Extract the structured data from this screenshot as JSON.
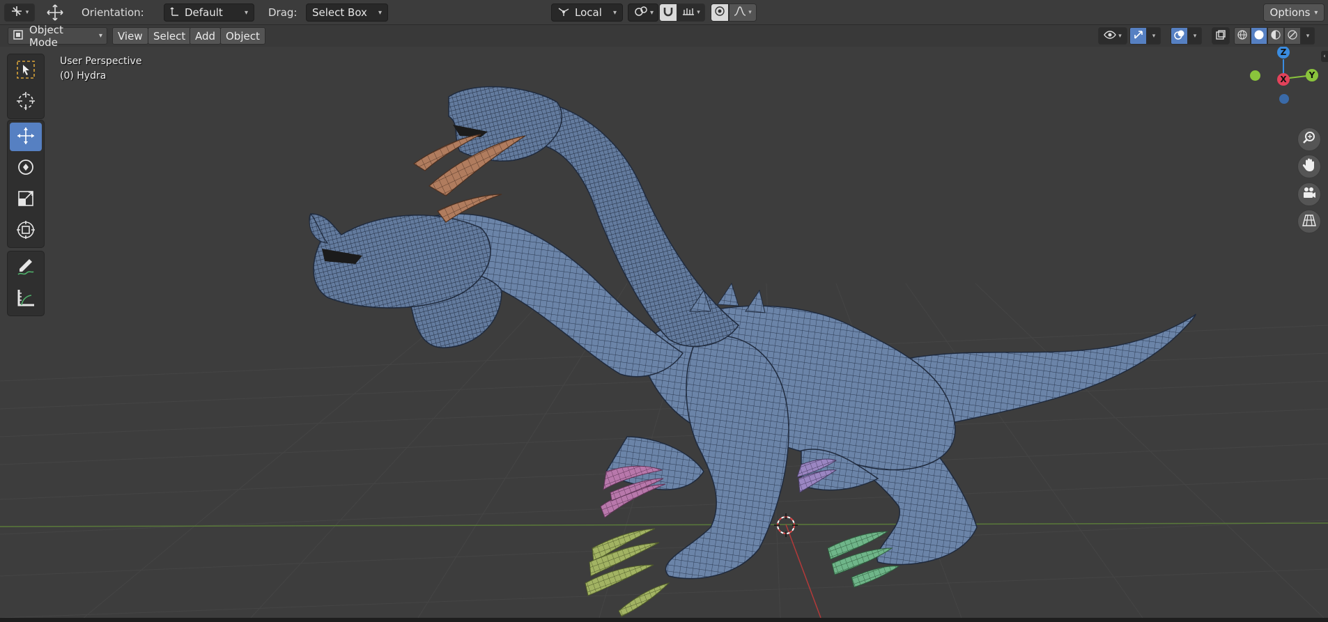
{
  "header": {
    "orientation_label": "Orientation:",
    "orientation_value": "Default",
    "drag_label": "Drag:",
    "drag_value": "Select Box",
    "transform_space_value": "Local",
    "options_label": "Options"
  },
  "viewport_header": {
    "mode": "Object Mode",
    "menus": [
      "View",
      "Select",
      "Add",
      "Object"
    ]
  },
  "viewport": {
    "view_name": "User Perspective",
    "object_name": "(0) Hydra"
  },
  "gizmo": {
    "z_label": "Z",
    "y_label": "Y",
    "x_label": "X",
    "colors": {
      "x": "#e2425a",
      "y": "#8ac43c",
      "z": "#3a8ce0"
    }
  },
  "tools": [
    "select-box",
    "cursor",
    "move",
    "rotate",
    "scale",
    "transform",
    "annotate",
    "measure"
  ],
  "active_tool": "move",
  "colors": {
    "accent": "#5680c2",
    "mesh": "#6b84a8",
    "horn": "#b07c5e",
    "claw_front": "#b878ab",
    "claw_back": "#a2b363",
    "claw_rear": "#6fb589"
  }
}
